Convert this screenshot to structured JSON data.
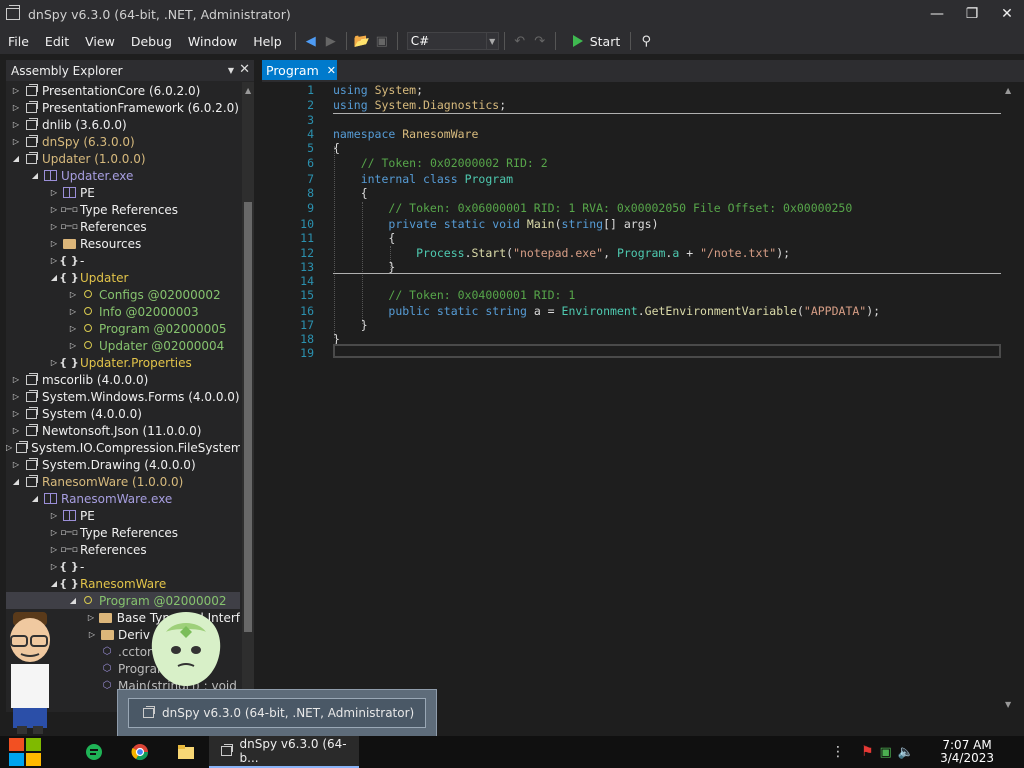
{
  "window": {
    "title": "dnSpy v6.3.0 (64-bit, .NET, Administrator)"
  },
  "menu": [
    "File",
    "Edit",
    "View",
    "Debug",
    "Window",
    "Help"
  ],
  "toolbar": {
    "language": "C#",
    "start_label": "Start"
  },
  "assembly_explorer": {
    "title": "Assembly Explorer",
    "rows": [
      {
        "text": "PresentationCore (6.0.2.0)",
        "level": 0,
        "expanded": false,
        "icon": "assembly-icon",
        "color": "white"
      },
      {
        "text": "PresentationFramework (6.0.2.0)",
        "level": 0,
        "expanded": false,
        "icon": "assembly-icon",
        "color": "white"
      },
      {
        "text": "dnlib (3.6.0.0)",
        "level": 0,
        "expanded": false,
        "icon": "assembly-icon",
        "color": "white"
      },
      {
        "text": "dnSpy (6.3.0.0)",
        "level": 0,
        "expanded": false,
        "icon": "assembly-icon",
        "color": "yellow"
      },
      {
        "text": "Updater (1.0.0.0)",
        "level": 0,
        "expanded": true,
        "icon": "assembly-icon",
        "color": "yellow"
      },
      {
        "text": "Updater.exe",
        "level": 1,
        "expanded": true,
        "icon": "module-icon",
        "color": "purple"
      },
      {
        "text": "PE",
        "level": 2,
        "expanded": false,
        "icon": "module-icon",
        "color": "white"
      },
      {
        "text": "Type References",
        "level": 2,
        "expanded": false,
        "icon": "reference-icon",
        "color": "white"
      },
      {
        "text": "References",
        "level": 2,
        "expanded": false,
        "icon": "reference-icon",
        "color": "white"
      },
      {
        "text": "Resources",
        "level": 2,
        "expanded": false,
        "icon": "folder-icon",
        "color": "white"
      },
      {
        "text": "-",
        "level": 2,
        "expanded": false,
        "icon": "namespace-icon",
        "color": "white"
      },
      {
        "text": "Updater",
        "level": 2,
        "expanded": true,
        "icon": "namespace-icon",
        "color": "gold"
      },
      {
        "text": "Configs @02000002",
        "level": 3,
        "expanded": false,
        "icon": "class-icon",
        "color": "green"
      },
      {
        "text": "Info @02000003",
        "level": 3,
        "expanded": false,
        "icon": "class-icon",
        "color": "green"
      },
      {
        "text": "Program @02000005",
        "level": 3,
        "expanded": false,
        "icon": "class-icon",
        "color": "green"
      },
      {
        "text": "Updater @02000004",
        "level": 3,
        "expanded": false,
        "icon": "class-icon",
        "color": "green"
      },
      {
        "text": "Updater.Properties",
        "level": 2,
        "expanded": false,
        "icon": "namespace-icon",
        "color": "gold"
      },
      {
        "text": "mscorlib (4.0.0.0)",
        "level": 0,
        "expanded": false,
        "icon": "assembly-icon",
        "color": "white"
      },
      {
        "text": "System.Windows.Forms (4.0.0.0)",
        "level": 0,
        "expanded": false,
        "icon": "assembly-icon",
        "color": "white"
      },
      {
        "text": "System (4.0.0.0)",
        "level": 0,
        "expanded": false,
        "icon": "assembly-icon",
        "color": "white"
      },
      {
        "text": "Newtonsoft.Json (11.0.0.0)",
        "level": 0,
        "expanded": false,
        "icon": "assembly-icon",
        "color": "white"
      },
      {
        "text": "System.IO.Compression.FileSystem",
        "level": 0,
        "expanded": false,
        "icon": "assembly-icon",
        "color": "white"
      },
      {
        "text": "System.Drawing (4.0.0.0)",
        "level": 0,
        "expanded": false,
        "icon": "assembly-icon",
        "color": "white"
      },
      {
        "text": "RanesomWare (1.0.0.0)",
        "level": 0,
        "expanded": true,
        "icon": "assembly-icon",
        "color": "yellow"
      },
      {
        "text": "RanesomWare.exe",
        "level": 1,
        "expanded": true,
        "icon": "module-icon",
        "color": "purple"
      },
      {
        "text": "PE",
        "level": 2,
        "expanded": false,
        "icon": "module-icon",
        "color": "white"
      },
      {
        "text": "Type References",
        "level": 2,
        "expanded": false,
        "icon": "reference-icon",
        "color": "white"
      },
      {
        "text": "References",
        "level": 2,
        "expanded": false,
        "icon": "reference-icon",
        "color": "white"
      },
      {
        "text": "-",
        "level": 2,
        "expanded": false,
        "icon": "namespace-icon",
        "color": "white"
      },
      {
        "text": "RanesomWare",
        "level": 2,
        "expanded": true,
        "icon": "namespace-icon",
        "color": "gold"
      },
      {
        "text": "Program @02000002",
        "level": 3,
        "expanded": true,
        "icon": "class-icon",
        "color": "green",
        "selected": true
      },
      {
        "text": "Base Type and Interf",
        "level": 4,
        "expanded": false,
        "icon": "folder-icon",
        "color": "white"
      },
      {
        "text": "Deriv",
        "level": 4,
        "expanded": false,
        "icon": "folder-icon",
        "color": "white"
      },
      {
        "text": ".cctor",
        "level": 4,
        "expanded": null,
        "icon": "method-icon",
        "color": "grey"
      },
      {
        "text": "Program",
        "level": 4,
        "expanded": null,
        "icon": "method-icon",
        "color": "grey"
      },
      {
        "text": "Main(string[]) : void",
        "level": 4,
        "expanded": null,
        "icon": "method-icon",
        "color": "grey"
      }
    ]
  },
  "editor": {
    "tab_label": "Program",
    "line_numbers": [
      "1",
      "2",
      "3",
      "4",
      "5",
      "6",
      "7",
      "8",
      "9",
      "10",
      "11",
      "12",
      "13",
      "14",
      "15",
      "16",
      "17",
      "18",
      "19"
    ]
  },
  "taskbar": {
    "active_app_label": "dnSpy v6.3.0 (64-b...",
    "time": "7:07 AM",
    "date": "3/4/2023",
    "preview_label": "dnSpy v6.3.0 (64-bit, .NET, Administrator)"
  },
  "colors": {
    "accent": "#007acc",
    "keyword": "#569cd6",
    "type": "#4ec9b0",
    "comment": "#57a64a",
    "string": "#d69d85"
  }
}
